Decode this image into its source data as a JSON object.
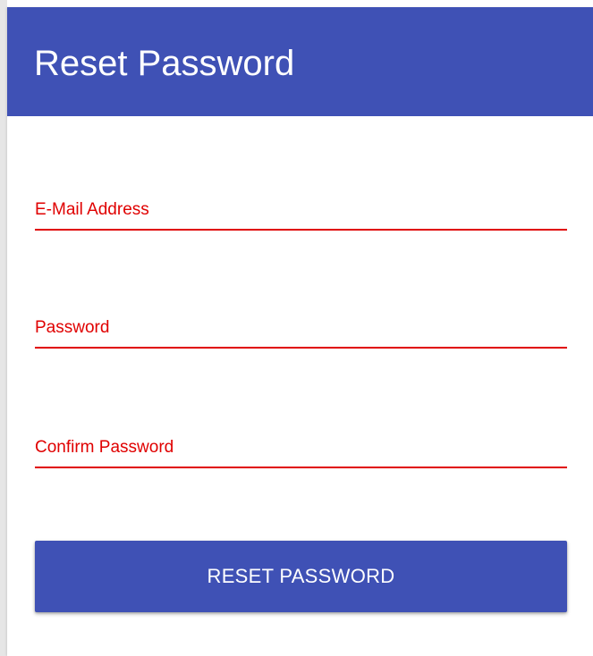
{
  "card": {
    "title": "Reset Password"
  },
  "form": {
    "email_label": "E-Mail Address",
    "email_value": "",
    "password_label": "Password",
    "password_value": "",
    "confirm_label": "Confirm Password",
    "confirm_value": "",
    "submit_label": "RESET PASSWORD"
  },
  "colors": {
    "header_bg": "#3f51b5",
    "button_bg": "#3f51b5",
    "error_red": "#e00000",
    "title_text": "#ffffff"
  }
}
